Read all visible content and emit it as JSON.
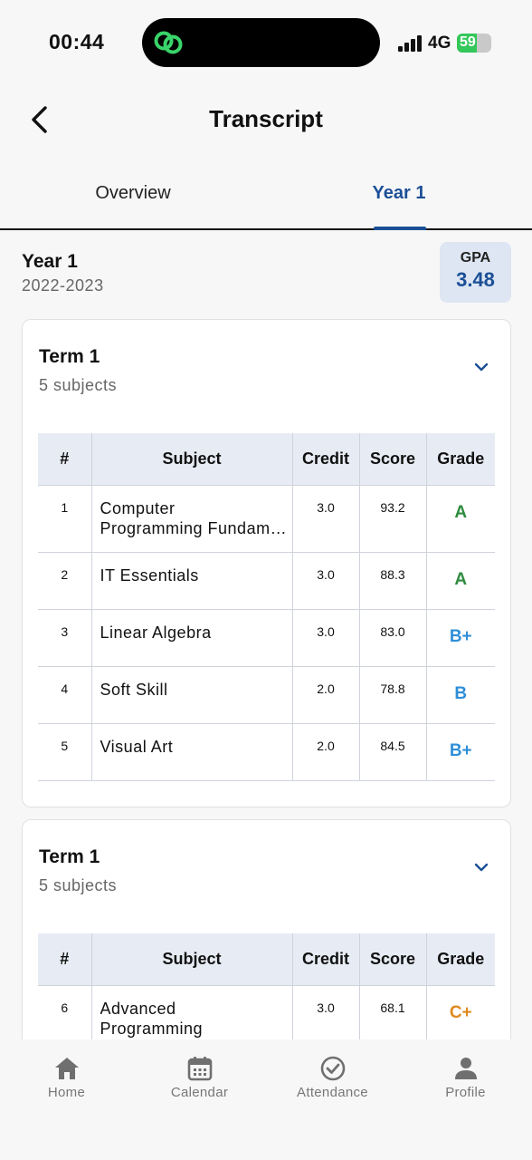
{
  "status_bar": {
    "time": "00:44",
    "network": "4G",
    "battery": "59"
  },
  "header": {
    "title": "Transcript"
  },
  "tabs": [
    {
      "label": "Overview",
      "active": false
    },
    {
      "label": "Year 1",
      "active": true
    }
  ],
  "year": {
    "title": "Year 1",
    "range": "2022-2023",
    "gpa_label": "GPA",
    "gpa_value": "3.48"
  },
  "table_headers": {
    "num": "#",
    "subject": "Subject",
    "credit": "Credit",
    "score": "Score",
    "grade": "Grade"
  },
  "terms": [
    {
      "title": "Term 1",
      "subtitle": "5 subjects",
      "rows": [
        {
          "num": "1",
          "subject_line1": "Computer",
          "subject_line2": "Programming Fundam…",
          "credit": "3.0",
          "score": "93.2",
          "grade": "A"
        },
        {
          "num": "2",
          "subject": "IT Essentials",
          "credit": "3.0",
          "score": "88.3",
          "grade": "A"
        },
        {
          "num": "3",
          "subject": "Linear Algebra",
          "credit": "3.0",
          "score": "83.0",
          "grade": "B+"
        },
        {
          "num": "4",
          "subject": "Soft Skill",
          "credit": "2.0",
          "score": "78.8",
          "grade": "B"
        },
        {
          "num": "5",
          "subject": "Visual Art",
          "credit": "2.0",
          "score": "84.5",
          "grade": "B+"
        }
      ]
    },
    {
      "title": "Term 1",
      "subtitle": "5 subjects",
      "rows": [
        {
          "num": "6",
          "subject_line1": "Advanced",
          "subject_line2": "Programming",
          "credit": "3.0",
          "score": "68.1",
          "grade": "C+"
        }
      ]
    }
  ],
  "grade_colors": {
    "A": "#2e8b3e",
    "B+": "#2f8fd8",
    "B": "#2f8fd8",
    "C+": "#e08a1e"
  },
  "bottom_nav": [
    {
      "label": "Home",
      "icon": "home-icon"
    },
    {
      "label": "Calendar",
      "icon": "calendar-icon"
    },
    {
      "label": "Attendance",
      "icon": "check-circle-icon"
    },
    {
      "label": "Profile",
      "icon": "person-icon"
    }
  ]
}
